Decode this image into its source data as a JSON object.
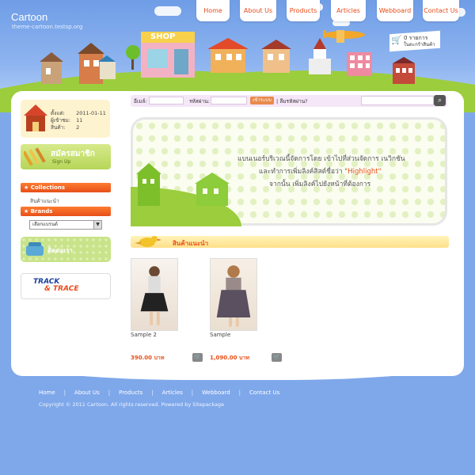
{
  "header": {
    "site_name": "Cartoon",
    "domain": "theme-cartoon.testsp.org",
    "shop_sign": "SHOP",
    "nav": [
      "Home",
      "About Us",
      "Products",
      "Articles",
      "Webboard",
      "Contact Us"
    ],
    "cart": {
      "count": "0 รายการ",
      "label": "ในตะกร้าสินค้า"
    }
  },
  "member": {
    "rows": [
      {
        "label": "ตั้งแต่:",
        "value": "2011-01-11"
      },
      {
        "label": "ผู้เข้าชม:",
        "value": "11"
      },
      {
        "label": "สินค้า:",
        "value": "2"
      }
    ]
  },
  "signup": {
    "title": "สมัครสมาชิก",
    "subtitle": "Sign Up"
  },
  "sidebar": {
    "collections_title": "Collections",
    "collection_link": "สินค้าแนะนำ",
    "brands_title": "Brands",
    "brand_select": "เลือกแบรนด์"
  },
  "contact": {
    "label": "ติดต่อเรา"
  },
  "track": {
    "line1": "TRACK",
    "line2": "& TRACE"
  },
  "login": {
    "email_label": "อีเมล์:",
    "password_label": "รหัสผ่าน:",
    "login_button": "เข้าระบบ",
    "forgot": "| ลืมรหัสผ่าน?"
  },
  "banner": {
    "line1": "แบนเนอร์บริเวณนี้จัดการโดย เข้าไปที่ส่วนจัดการ เนวิกชัน",
    "line2_prefix": "และทำการเพิ่มลิงค์สิสต์ชื่อว่า ",
    "line2_highlight": "\"Highlight\"",
    "line3": "จากนั้น เพิ่มลิงค์ไปยังหน้าที่ต้องการ"
  },
  "recommended": {
    "title": "สินค้าแนะนำ",
    "products": [
      {
        "name": "Sample 2",
        "price": "390.00 บาท"
      },
      {
        "name": "Sample",
        "price": "1,090.00 บาท"
      }
    ]
  },
  "footer": {
    "links": [
      "Home",
      "About Us",
      "Products",
      "Articles",
      "Webboard",
      "Contact Us"
    ],
    "copyright": "Copyright © 2011 Cartoon. All rights reserved. Powered by Sitepackage"
  }
}
